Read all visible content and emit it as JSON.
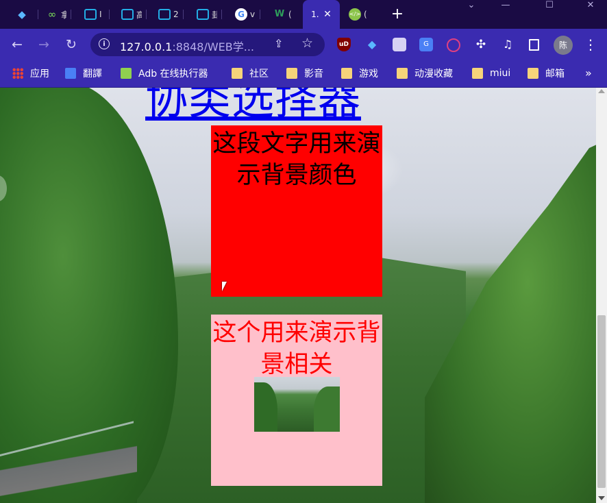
{
  "browser": {
    "tabs": [
      {
        "title": "",
        "icon": "sketch-gem-icon",
        "color": "#5ab8ff"
      },
      {
        "title": "拿",
        "icon": "infinity-icon",
        "color": "#7de05a"
      },
      {
        "title": "I",
        "icon": "bilibili-icon",
        "color": "#23ade5"
      },
      {
        "title": "高",
        "icon": "bilibili-icon",
        "color": "#23ade5"
      },
      {
        "title": "2",
        "icon": "bilibili-icon",
        "color": "#23ade5"
      },
      {
        "title": "卦",
        "icon": "bilibili-icon",
        "color": "#23ade5"
      },
      {
        "title": "v",
        "icon": "google-icon",
        "color": "#ffffff"
      },
      {
        "title": "(",
        "icon": "w3-icon",
        "color": "#2e9e5b"
      },
      {
        "title": "1.",
        "icon": "",
        "color": "#ffffff",
        "active": true
      },
      {
        "title": "(",
        "icon": "code-icon",
        "color": "#8bc34a"
      }
    ],
    "address": {
      "host": "127.0.0.1",
      "path": ":8848/WEB学..."
    },
    "profile_initial": "陈",
    "bookmarks": [
      {
        "label": "应用",
        "icon": "apps-grid-icon"
      },
      {
        "label": "翻譯",
        "icon": "translate-icon"
      },
      {
        "label": "Adb 在线执行器",
        "icon": "android-icon"
      },
      {
        "label": "社区",
        "icon": "folder-icon"
      },
      {
        "label": "影音",
        "icon": "folder-icon"
      },
      {
        "label": "游戏",
        "icon": "folder-icon"
      },
      {
        "label": "动漫收藏",
        "icon": "folder-icon"
      },
      {
        "label": "miui",
        "icon": "folder-icon"
      },
      {
        "label": "邮箱",
        "icon": "folder-icon"
      }
    ],
    "bookmarks_more": "»"
  },
  "page": {
    "title": "协类选择器",
    "red_box_text": "这段文字用来演示背景颜色",
    "pink_box_text": "这个用来演示背景相关"
  }
}
